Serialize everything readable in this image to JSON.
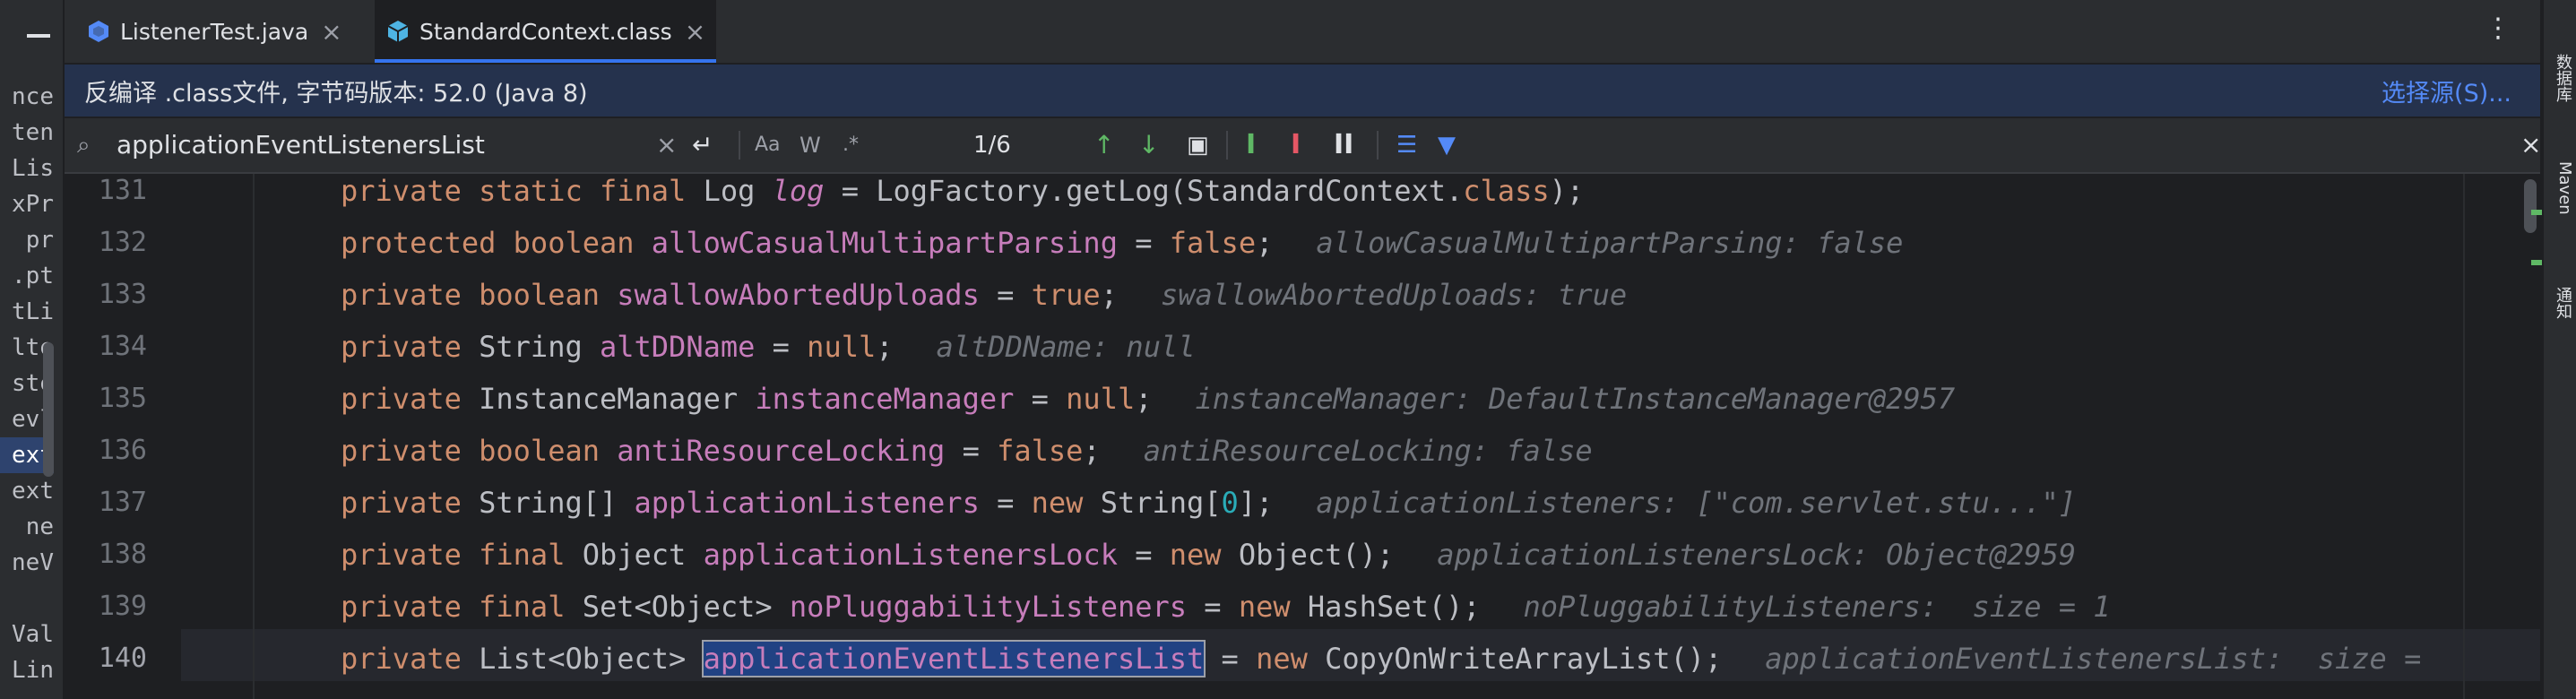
{
  "project_panel": {
    "fragments": [
      "nce",
      "ten",
      "Lis",
      "xPr",
      "pr",
      ".pt",
      "tLi",
      "lte",
      "ste",
      "evl",
      "ext",
      "ext",
      "ne",
      "neV",
      "",
      "Val",
      "Lin"
    ],
    "selected_index": 10
  },
  "tabs": [
    {
      "label": "ListenerTest.java",
      "icon": "java-class-icon",
      "active": false
    },
    {
      "label": "StandardContext.class",
      "icon": "class-file-icon",
      "active": true
    }
  ],
  "infobar": {
    "message": "反编译 .class文件, 字节码版本: 52.0 (Java 8)",
    "link": "选择源(S)..."
  },
  "find": {
    "query": "applicationEventListenersList",
    "match_case_label": "Aa",
    "whole_word_label": "W",
    "regex_label": ".*",
    "count": "1/6"
  },
  "editor": {
    "lines": [
      {
        "num": "131",
        "tokens": [
          [
            "kw",
            "private static final "
          ],
          [
            "",
            "Log "
          ],
          [
            "fd it",
            "log"
          ],
          [
            "",
            " = LogFactory.getLog(StandardContext."
          ],
          [
            "kw",
            "class"
          ],
          [
            "",
            ");"
          ]
        ],
        "hint": ""
      },
      {
        "num": "132",
        "tokens": [
          [
            "kw",
            "protected boolean "
          ],
          [
            "fd",
            "allowCasualMultipartParsing"
          ],
          [
            "",
            " = "
          ],
          [
            "kw",
            "false"
          ],
          [
            "",
            ";"
          ]
        ],
        "hint": "allowCasualMultipartParsing: false"
      },
      {
        "num": "133",
        "tokens": [
          [
            "kw",
            "private boolean "
          ],
          [
            "fd",
            "swallowAbortedUploads"
          ],
          [
            "",
            " = "
          ],
          [
            "kw",
            "true"
          ],
          [
            "",
            ";"
          ]
        ],
        "hint": "swallowAbortedUploads: true"
      },
      {
        "num": "134",
        "tokens": [
          [
            "kw",
            "private "
          ],
          [
            "",
            "String "
          ],
          [
            "fd",
            "altDDName"
          ],
          [
            "",
            " = "
          ],
          [
            "kw",
            "null"
          ],
          [
            "",
            ";"
          ]
        ],
        "hint": "altDDName: null"
      },
      {
        "num": "135",
        "tokens": [
          [
            "kw",
            "private "
          ],
          [
            "",
            "InstanceManager "
          ],
          [
            "fd",
            "instanceManager"
          ],
          [
            "",
            " = "
          ],
          [
            "kw",
            "null"
          ],
          [
            "",
            ";"
          ]
        ],
        "hint": "instanceManager: DefaultInstanceManager@2957"
      },
      {
        "num": "136",
        "tokens": [
          [
            "kw",
            "private boolean "
          ],
          [
            "fd",
            "antiResourceLocking"
          ],
          [
            "",
            " = "
          ],
          [
            "kw",
            "false"
          ],
          [
            "",
            ";"
          ]
        ],
        "hint": "antiResourceLocking: false"
      },
      {
        "num": "137",
        "tokens": [
          [
            "kw",
            "private "
          ],
          [
            "",
            "String[] "
          ],
          [
            "fd",
            "applicationListeners"
          ],
          [
            "",
            " = "
          ],
          [
            "kw",
            "new "
          ],
          [
            "",
            "String["
          ],
          [
            "num",
            "0"
          ],
          [
            "",
            "];"
          ]
        ],
        "hint": "applicationListeners: [\"com.servlet.stu...\"]"
      },
      {
        "num": "138",
        "tokens": [
          [
            "kw",
            "private final "
          ],
          [
            "",
            "Object "
          ],
          [
            "fd",
            "applicationListenersLock"
          ],
          [
            "",
            " = "
          ],
          [
            "kw",
            "new "
          ],
          [
            "",
            "Object();"
          ]
        ],
        "hint": "applicationListenersLock: Object@2959"
      },
      {
        "num": "139",
        "tokens": [
          [
            "kw",
            "private final "
          ],
          [
            "",
            "Set<Object> "
          ],
          [
            "fd",
            "noPluggabilityListeners"
          ],
          [
            "",
            " = "
          ],
          [
            "kw",
            "new "
          ],
          [
            "",
            "HashSet();"
          ]
        ],
        "hint": "noPluggabilityListeners:  size = 1"
      },
      {
        "num": "140",
        "tokens": [
          [
            "kw",
            "private "
          ],
          [
            "",
            "List<Object> "
          ],
          [
            "fd hl",
            "applicationEventListenersList"
          ],
          [
            "",
            " = "
          ],
          [
            "kw",
            "new "
          ],
          [
            "",
            "CopyOnWriteArrayList();"
          ]
        ],
        "hint": "applicationEventListenersList:  size ="
      }
    ],
    "current_line": "140"
  },
  "right_strip": [
    "数据库",
    "Maven",
    "通知"
  ],
  "colors": {
    "keyword": "#cf8e6d",
    "field": "#c77dbb",
    "number": "#2aacb8",
    "hint": "#6f737a",
    "accent": "#3574f0"
  }
}
